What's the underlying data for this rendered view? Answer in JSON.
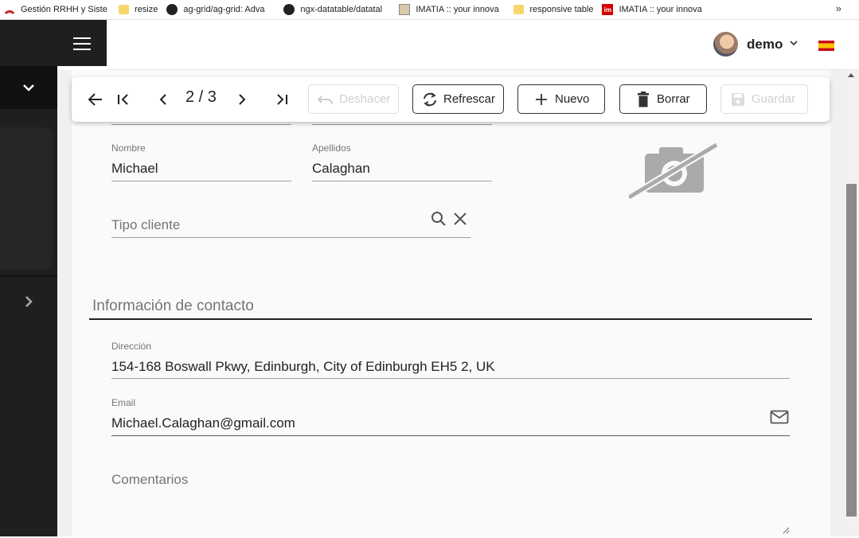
{
  "bookmarks": [
    {
      "label": "Gestión RRHH y Siste",
      "icon": "gestion-icon"
    },
    {
      "label": "resize",
      "icon": "folder-icon"
    },
    {
      "label": "ag-grid/ag-grid: Adva",
      "icon": "github-icon"
    },
    {
      "label": "ngx-datatable/datatal",
      "icon": "github-icon"
    },
    {
      "label": "IMATIA :: your innova",
      "icon": "image-icon"
    },
    {
      "label": "responsive table",
      "icon": "folder-icon"
    },
    {
      "label": "IMATIA :: your innova",
      "icon": "imatia-icon"
    }
  ],
  "bookmarks_more": "»",
  "header": {
    "username": "demo",
    "language_flag": "es-flag-icon"
  },
  "toolbar": {
    "pager_text": "2 / 3",
    "undo_label": "Deshacer",
    "refresh_label": "Refrescar",
    "new_label": "Nuevo",
    "delete_label": "Borrar",
    "save_label": "Guardar"
  },
  "form": {
    "nombre_label": "Nombre",
    "nombre_value": "Michael",
    "apellidos_label": "Apellidos",
    "apellidos_value": "Calaghan",
    "tipo_cliente_placeholder": "Tipo cliente",
    "section_title": "Información de contacto",
    "direccion_label": "Dirección",
    "direccion_value": "154-168 Boswall Pkwy, Edinburgh, City of Edinburgh EH5 2, UK",
    "email_label": "Email",
    "email_value": "Michael.Calaghan@gmail.com",
    "comentarios_placeholder": "Comentarios"
  },
  "colors": {
    "sidebar": "#1f1f1f",
    "header": "#ffffff",
    "background": "#f0f0f0"
  }
}
